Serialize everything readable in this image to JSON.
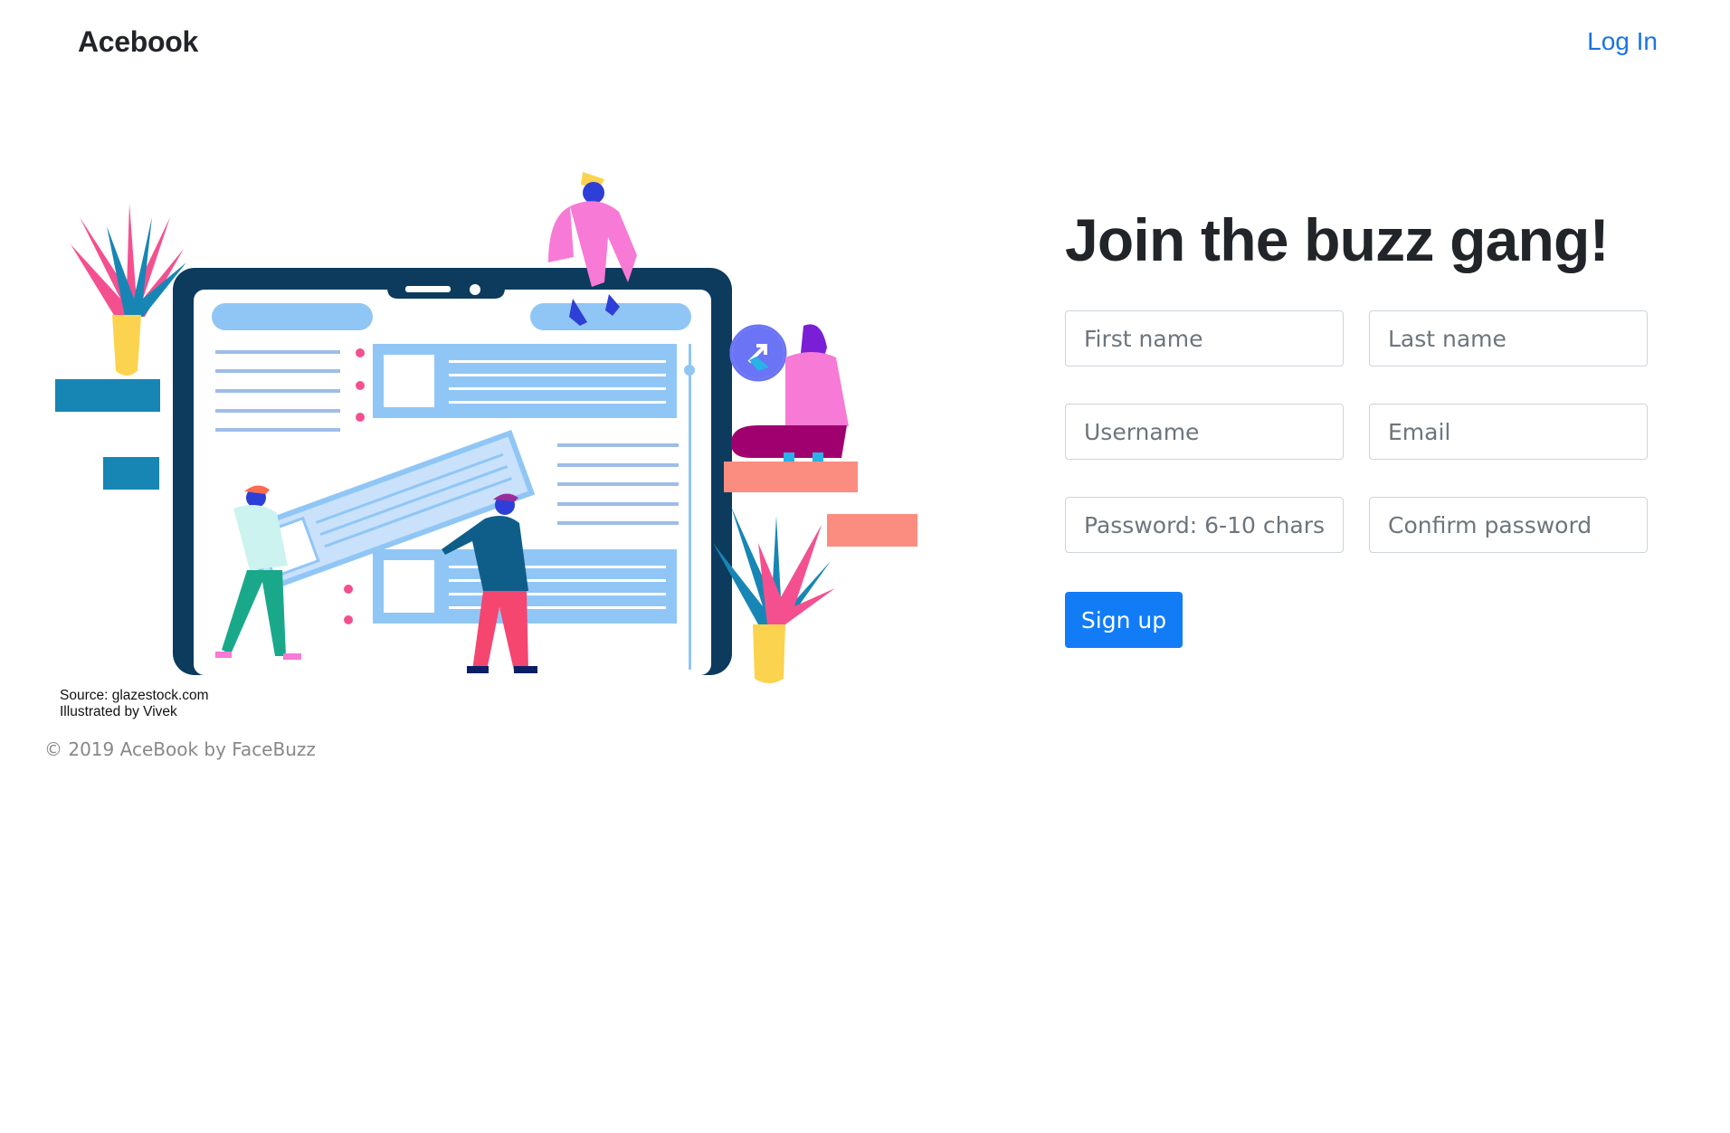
{
  "nav": {
    "brand": "Acebook",
    "login": "Log In"
  },
  "illustration": {
    "credit_source": "Source: glazestock.com",
    "credit_illustrator": "Illustrated by Vivek"
  },
  "footer": {
    "copyright": "© 2019 AceBook by FaceBuzz"
  },
  "signup": {
    "heading": "Join the buzz gang!",
    "first_name_placeholder": "First name",
    "last_name_placeholder": "Last name",
    "username_placeholder": "Username",
    "email_placeholder": "Email",
    "password_placeholder": "Password: 6-10 chars",
    "confirm_password_placeholder": "Confirm password",
    "submit_label": "Sign up"
  },
  "colors": {
    "link": "#1a73e8",
    "primary_button": "#127cf7",
    "laptop_frame": "#0c3b5e",
    "panel_blue": "#90c6f5",
    "plant_teal": "#1786b5",
    "pink": "#f77ad6",
    "salmon": "#fb8d80",
    "vase_yellow": "#fbd34f"
  }
}
